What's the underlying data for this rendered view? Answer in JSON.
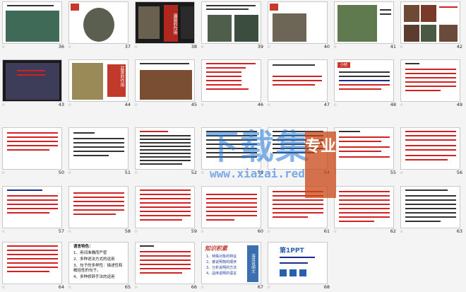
{
  "slides": [
    {
      "num": "36"
    },
    {
      "num": "37"
    },
    {
      "num": "38"
    },
    {
      "num": "39"
    },
    {
      "num": "40"
    },
    {
      "num": "41"
    },
    {
      "num": "42"
    },
    {
      "num": "43"
    },
    {
      "num": "44"
    },
    {
      "num": "45"
    },
    {
      "num": "46"
    },
    {
      "num": "47"
    },
    {
      "num": "48"
    },
    {
      "num": "49"
    },
    {
      "num": "50"
    },
    {
      "num": "51"
    },
    {
      "num": "52"
    },
    {
      "num": "53"
    },
    {
      "num": "54"
    },
    {
      "num": "55"
    },
    {
      "num": "56"
    },
    {
      "num": "57"
    },
    {
      "num": "58"
    },
    {
      "num": "59"
    },
    {
      "num": "60"
    },
    {
      "num": "61"
    },
    {
      "num": "62"
    },
    {
      "num": "63"
    },
    {
      "num": "64"
    },
    {
      "num": "65"
    },
    {
      "num": "66"
    },
    {
      "num": "67"
    },
    {
      "num": "68"
    }
  ],
  "star_glyph": "☆",
  "slide38_title": "漏窗的作用",
  "slide44_title": "盆景的作用",
  "slide47_tag": "小结",
  "slide65_heading": "语言特色：",
  "slide65_items": [
    "1、用词准确而严密",
    "2、多种说法方式的运用",
    "3、句子的多样性：描述性和概括性的句子。",
    "4、多种修辞手法的运用"
  ],
  "slide67_title": "知识积累",
  "slide67_items": [
    "1、特殊对象的特征",
    "2、被说明物的顺序",
    "3、分析说明的方法",
    "4、品味说明的语言"
  ],
  "slide67_side": "海滨说明文",
  "slide68_logo": "第1PPT",
  "watermark_main": "下载集",
  "watermark_badge": "专业",
  "watermark_url": "www.xiazai.red"
}
